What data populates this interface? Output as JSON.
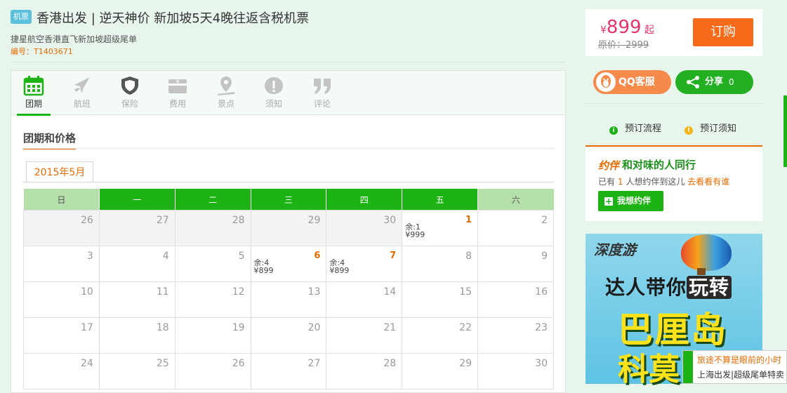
{
  "header": {
    "tag": "机票",
    "title": "香港出发 | 逆天神价 新加坡5天4晚往返含税机票",
    "subtitle": "捷星航空香港直飞新加坡超级尾单",
    "code": "编号：T1403671"
  },
  "tabs": [
    {
      "label": "团期",
      "icon": "calendar-icon",
      "active": true
    },
    {
      "label": "航班",
      "icon": "plane-icon"
    },
    {
      "label": "保险",
      "icon": "shield-icon"
    },
    {
      "label": "费用",
      "icon": "yen-card-icon"
    },
    {
      "label": "景点",
      "icon": "map-pin-icon"
    },
    {
      "label": "须知",
      "icon": "warning-icon"
    },
    {
      "label": "评论",
      "icon": "quote-icon"
    }
  ],
  "section": {
    "title": "团期和价格",
    "month_tab": "2015年5月"
  },
  "calendar": {
    "weekdays": [
      "日",
      "一",
      "二",
      "三",
      "四",
      "五",
      "六"
    ],
    "weeks": [
      [
        {
          "day": "26",
          "past": true
        },
        {
          "day": "27",
          "past": true
        },
        {
          "day": "28",
          "past": true
        },
        {
          "day": "29",
          "past": true
        },
        {
          "day": "30",
          "past": true
        },
        {
          "day": "1",
          "hot": true,
          "remain": "余:1",
          "price": "¥999"
        },
        {
          "day": "2"
        }
      ],
      [
        {
          "day": "3"
        },
        {
          "day": "4"
        },
        {
          "day": "5"
        },
        {
          "day": "6",
          "hot": true,
          "remain": "余:4",
          "price": "¥899"
        },
        {
          "day": "7",
          "hot": true,
          "remain": "余:4",
          "price": "¥899"
        },
        {
          "day": "8"
        },
        {
          "day": "9"
        }
      ],
      [
        {
          "day": "10"
        },
        {
          "day": "11"
        },
        {
          "day": "12"
        },
        {
          "day": "13"
        },
        {
          "day": "14"
        },
        {
          "day": "15"
        },
        {
          "day": "16"
        }
      ],
      [
        {
          "day": "17"
        },
        {
          "day": "18"
        },
        {
          "day": "19"
        },
        {
          "day": "20"
        },
        {
          "day": "21"
        },
        {
          "day": "22"
        },
        {
          "day": "23"
        }
      ],
      [
        {
          "day": "24"
        },
        {
          "day": "25"
        },
        {
          "day": "26"
        },
        {
          "day": "27"
        },
        {
          "day": "28"
        },
        {
          "day": "29"
        },
        {
          "day": "30"
        }
      ]
    ]
  },
  "price_box": {
    "currency": "¥",
    "price": "899",
    "from": "起",
    "orig_label": "原价：",
    "orig_price": "2999",
    "book_label": "订购"
  },
  "buttons": {
    "qq_label": "QQ客服",
    "share_label": "分享",
    "share_count": "0"
  },
  "flow": {
    "process_label": "预订流程",
    "notice_label": "预订须知"
  },
  "companion": {
    "logo": "约伴",
    "title": "和对味的人同行",
    "line_prefix": "已有",
    "count": "1",
    "line_mid": "人想约伴到这儿",
    "link": "去看看有谁",
    "button": "我想约伴"
  },
  "ad": {
    "brand": "深度游",
    "line1_a": "达人带你",
    "line1_b": "玩转",
    "line2": "巴厘岛",
    "line3": "科莫"
  },
  "toast": {
    "line1": "旅途不算是眼前的小时",
    "line2": "上海出发|超级尾单特卖"
  },
  "colors": {
    "green": "#1db314",
    "orange": "#e86b00",
    "price_pink": "#e8336d",
    "page_bg": "#e8f5ec"
  }
}
